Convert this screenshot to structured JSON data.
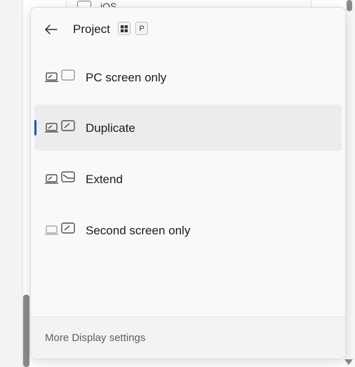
{
  "background": {
    "peek_text": "iOS"
  },
  "flyout": {
    "title": "Project",
    "shortcut_keys": [
      "⊞",
      "P"
    ],
    "options": [
      {
        "label": "PC screen only",
        "icon": "pc-screen-only-icon",
        "selected": false
      },
      {
        "label": "Duplicate",
        "icon": "duplicate-icon",
        "selected": true
      },
      {
        "label": "Extend",
        "icon": "extend-icon",
        "selected": false
      },
      {
        "label": "Second screen only",
        "icon": "second-screen-only-icon",
        "selected": false
      }
    ],
    "footer_link": "More Display settings",
    "accent_color": "#005fb8"
  }
}
